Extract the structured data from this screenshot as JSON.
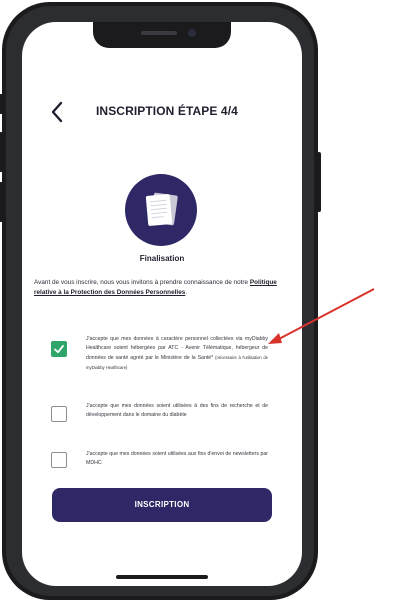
{
  "header": {
    "title": "INSCRIPTION ÉTAPE 4/4"
  },
  "step": {
    "name": "Finalisation"
  },
  "intro": {
    "text_before": "Avant de vous inscrire, nous vous invitons à prendre connaissance de notre ",
    "link": "Politique relative à la Protection des Données Personnelles",
    "text_after": "."
  },
  "consents": [
    {
      "checked": true,
      "text": "J'accepte que mes données à caractère personnel collectées via myDiabby Healthcare soient hébergées par ATC - Avenir Télématique, hébergeur de données de santé agréé par le Ministère de la Santé*",
      "note": "(nécessaire à l'utilisation de myDiabby Healthcare)"
    },
    {
      "checked": false,
      "text": "J'accepte que mes données soient utilisées à des fins de recherche et de développement dans le domaine du diabète"
    },
    {
      "checked": false,
      "text": "J'accepte que mes données soient utilisées aux fins d'envoi de newsletters par MDHC"
    }
  ],
  "cta": {
    "label": "INSCRIPTION"
  },
  "colors": {
    "brand": "#2e2867",
    "check": "#2fa56a",
    "annotation_arrow": "#d9322b"
  },
  "icons": {
    "back": "chevron-left-icon",
    "step": "documents-icon",
    "check": "checkmark-icon"
  }
}
